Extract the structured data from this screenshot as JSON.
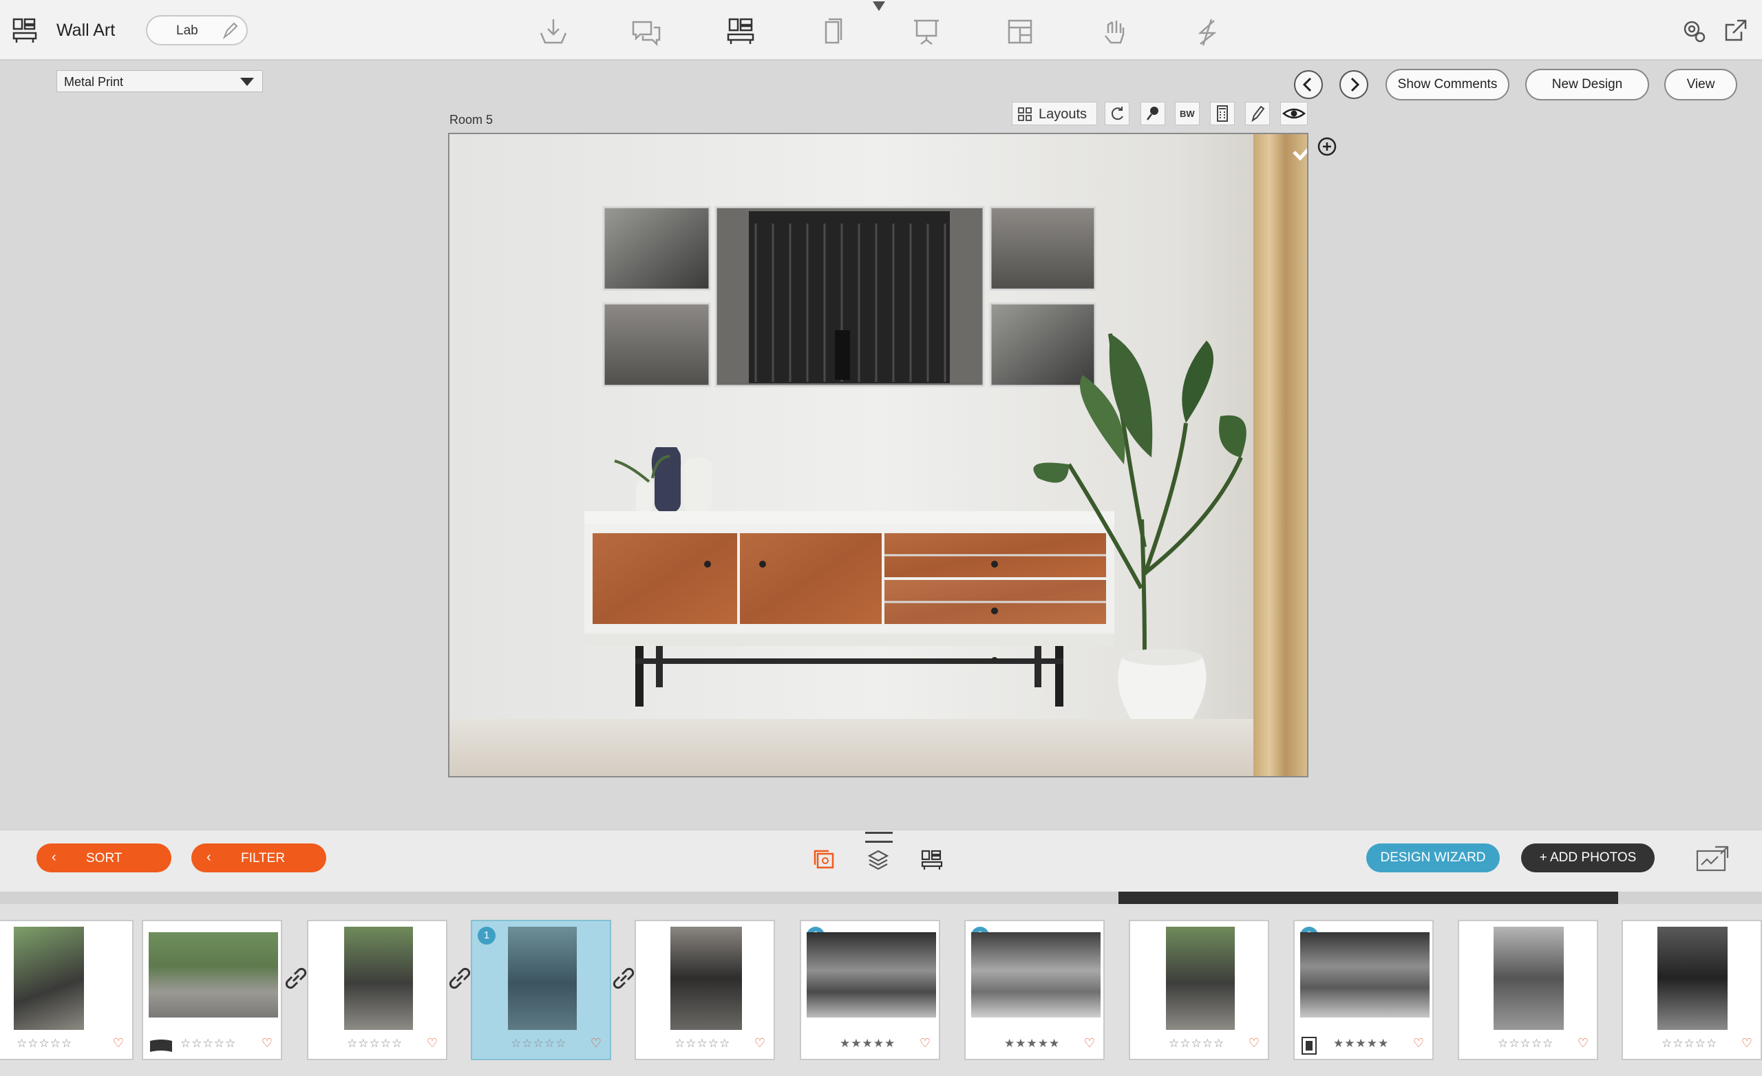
{
  "header": {
    "title": "Wall Art",
    "lab_label": "Lab"
  },
  "product": {
    "selected": "Metal Print"
  },
  "nav": {
    "show_comments": "Show Comments",
    "new_design": "New Design",
    "view": "View"
  },
  "canvas_toolbar": {
    "room_label": "Room 5",
    "layouts": "Layouts",
    "bw": "BW"
  },
  "bottom": {
    "sort": "SORT",
    "filter": "FILTER",
    "design_wizard": "DESIGN WIZARD",
    "add_photos": "+ ADD PHOTOS"
  },
  "filmstrip": {
    "stars": "☆☆☆☆☆",
    "filled_stars": "★★★★★",
    "selected_badge": "1",
    "count_badge": "3"
  },
  "colors": {
    "accent_orange": "#f05a1a",
    "wizard_blue": "#3fa3c7",
    "selected_bg": "#a8d6e6"
  }
}
